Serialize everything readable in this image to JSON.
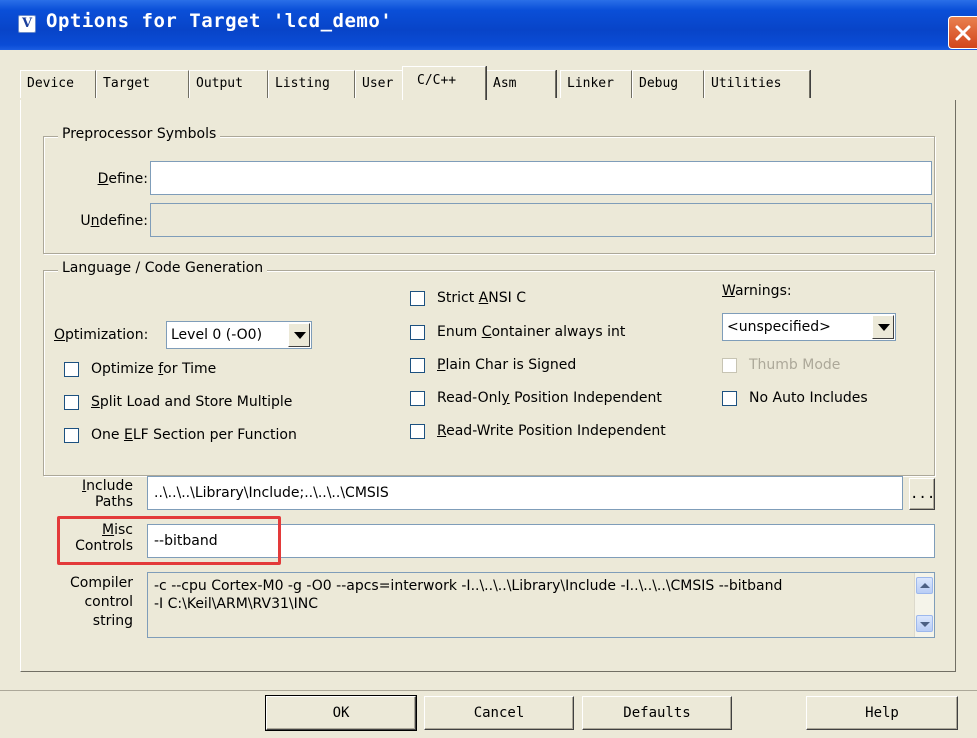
{
  "window": {
    "title": "Options for Target 'lcd_demo'",
    "icon_glyph": "V"
  },
  "tabs": [
    {
      "label": "Device"
    },
    {
      "label": "Target"
    },
    {
      "label": "Output"
    },
    {
      "label": "Listing"
    },
    {
      "label": "User"
    },
    {
      "label": "C/C++",
      "active": true
    },
    {
      "label": "Asm"
    },
    {
      "label": "Linker"
    },
    {
      "label": "Debug"
    },
    {
      "label": "Utilities"
    }
  ],
  "preprocessor": {
    "title": "Preprocessor Symbols",
    "define_label_u": "D",
    "define_label_rest": "efine:",
    "define_value": "",
    "undefine_label_pre": "U",
    "undefine_label_u": "n",
    "undefine_label_rest": "define:",
    "undefine_value": ""
  },
  "language": {
    "title": "Language / Code Generation",
    "optimization_label_u": "O",
    "optimization_label_rest": "ptimization:",
    "optimization_value": "Level 0 (-O0)",
    "optimize_time_pre": "Optimize ",
    "optimize_time_u": "f",
    "optimize_time_rest": "or Time",
    "split_u": "S",
    "split_rest": "plit Load and Store Multiple",
    "elf_pre": "One ",
    "elf_u": "E",
    "elf_rest": "LF Section per Function",
    "strict_pre": "Strict ",
    "strict_u": "A",
    "strict_rest": "NSI C",
    "enum_pre": "Enum ",
    "enum_u": "C",
    "enum_rest": "ontainer always int",
    "plain_pre": "",
    "plain_u": "P",
    "plain_rest": "lain Char is Signed",
    "ro_pre": "Read-Onl",
    "ro_u": "y",
    "ro_rest": " Position Independent",
    "rw_pre": "",
    "rw_u": "R",
    "rw_rest": "ead-Write Position Independent",
    "warnings_label_pre": "",
    "warnings_label_u": "W",
    "warnings_label_rest": "arnings:",
    "warnings_value": "<unspecified>",
    "thumb_mode": "Thumb Mode",
    "no_auto_includes": "No Auto Includes"
  },
  "include": {
    "label_line1_u": "I",
    "label_line1_rest": "nclude",
    "label_line2": "Paths",
    "value": "..\\..\\..\\Library\\Include;..\\..\\..\\CMSIS",
    "browse": "..."
  },
  "misc": {
    "label_line1_u": "M",
    "label_line1_rest": "isc",
    "label_line2": "Controls",
    "value": "--bitband"
  },
  "compiler": {
    "label_line1": "Compiler",
    "label_line2": "control",
    "label_line3": "string",
    "line1": "-c --cpu Cortex-M0 -g -O0 --apcs=interwork -I..\\..\\..\\Library\\Include -I..\\..\\..\\CMSIS --bitband",
    "line2": "-I C:\\Keil\\ARM\\RV31\\INC"
  },
  "buttons": {
    "ok": "OK",
    "cancel": "Cancel",
    "defaults": "Defaults",
    "help": "Help"
  },
  "colors": {
    "titlebar": "#0a4fd8",
    "highlight": "#e33a3a",
    "dialog_bg": "#ece9d8"
  }
}
